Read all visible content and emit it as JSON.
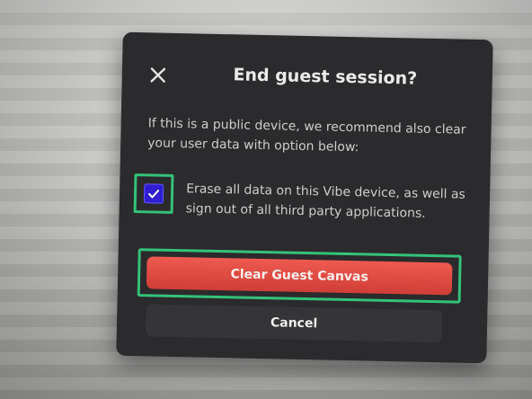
{
  "dialog": {
    "title": "End guest session?",
    "message": "If this is a public device, we recommend also clear your user data with option below:",
    "erase_option": {
      "label": "Erase all data on this Vibe device, as well as sign out of all third party applications.",
      "checked": true
    },
    "primary_button_label": "Clear Guest Canvas",
    "cancel_button_label": "Cancel"
  },
  "icons": {
    "close": "close-icon",
    "check": "checkmark-icon"
  },
  "colors": {
    "dialog_background": "#2b2a2c",
    "primary_button": "#e04a42",
    "checkbox_fill": "#2f1fd0",
    "highlight_outline": "#34c27a"
  }
}
